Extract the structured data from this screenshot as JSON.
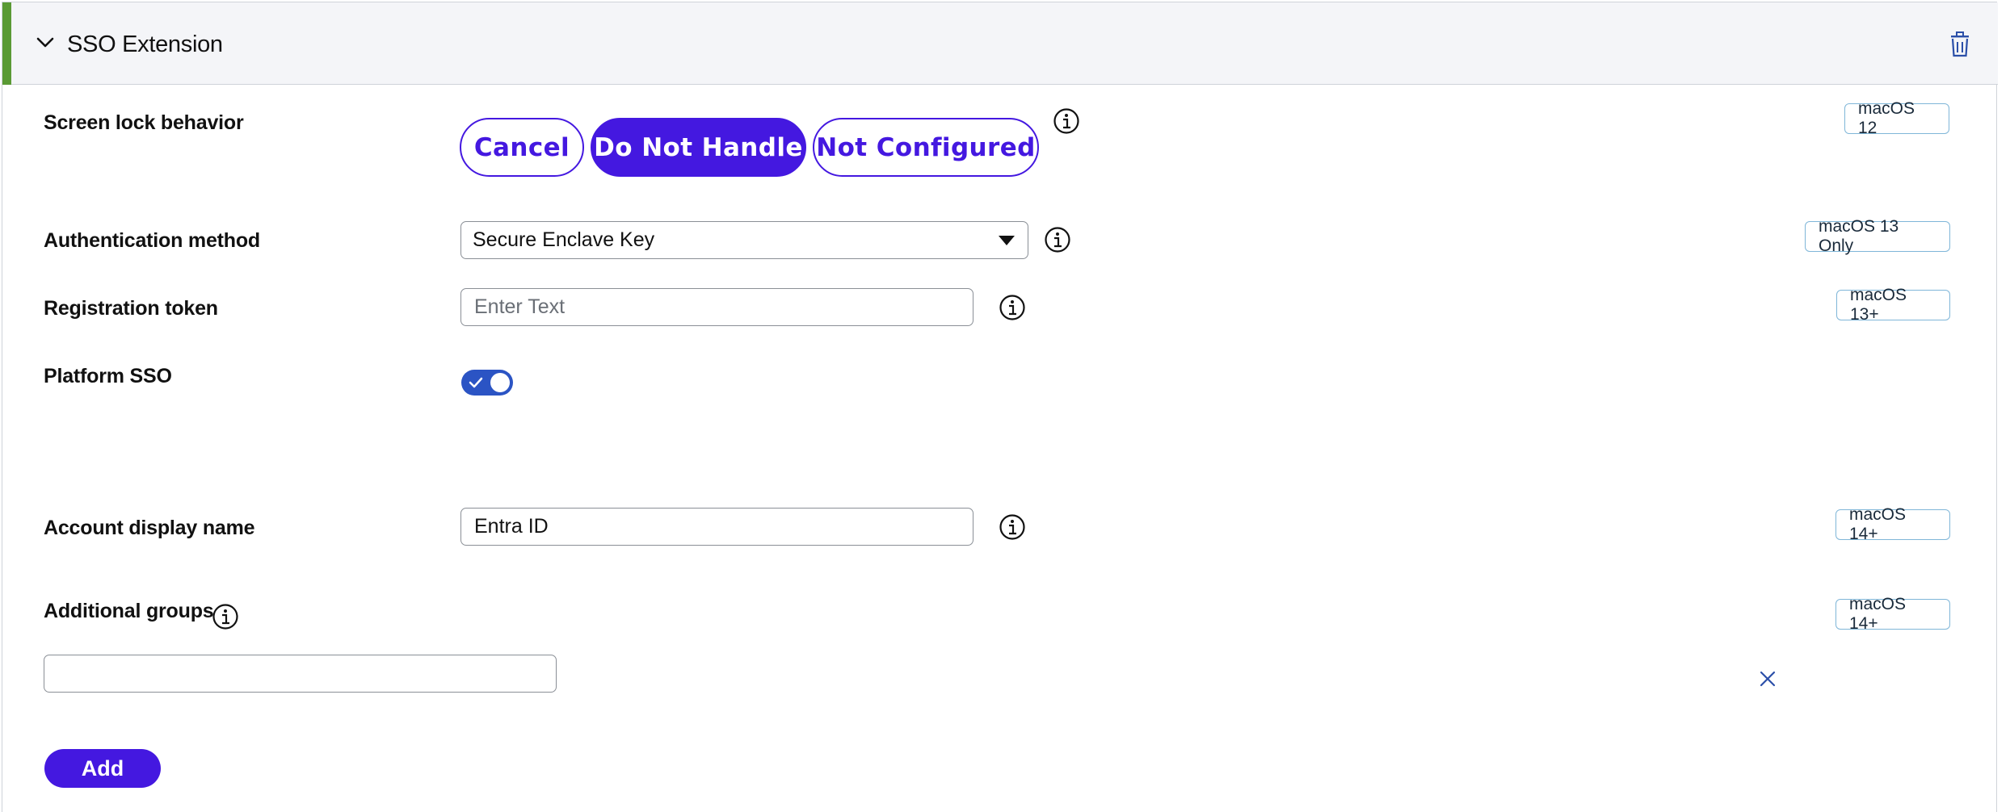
{
  "header": {
    "title": "SSO Extension",
    "accent_color": "#5a9a34",
    "collapse_icon": "chevron-down-icon",
    "delete_icon": "trash-icon"
  },
  "screen_lock": {
    "label": "Screen lock behavior",
    "options": [
      "Cancel",
      "Do Not Handle",
      "Not Configured"
    ],
    "selected": "Do Not Handle",
    "badge": "macOS 12"
  },
  "auth_method": {
    "label": "Authentication method",
    "value": "Secure Enclave Key",
    "badge": "macOS 13 Only"
  },
  "registration_token": {
    "label": "Registration token",
    "placeholder": "Enter Text",
    "badge": "macOS 13+"
  },
  "platform_sso": {
    "label": "Platform SSO",
    "enabled": true
  },
  "account_display_name": {
    "label": "Account display name",
    "value": "Entra ID",
    "badge": "macOS 14+"
  },
  "additional_groups": {
    "label": "Additional groups",
    "value": "",
    "badge": "macOS 14+",
    "add_label": "Add"
  },
  "colors": {
    "primary": "#4418e0",
    "toggle_on": "#2b54c4",
    "badge_border": "#7fb6d8"
  }
}
